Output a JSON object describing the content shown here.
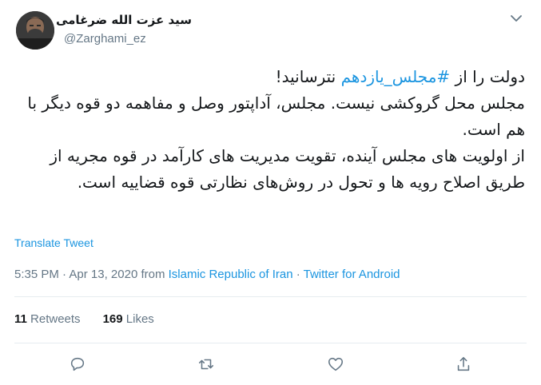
{
  "author": {
    "display_name": "سید عزت الله ضرغامی",
    "handle": "@Zarghami_ez"
  },
  "tweet": {
    "line1_prefix": "دولت را از ",
    "hashtag": "#مجلس_یازدهم",
    "line1_suffix": " نترسانید!",
    "para2": "مجلس محل گروکشی نیست. مجلس، آداپتور وصل و مفاهمه دو قوه دیگر با هم است.",
    "para3": "از اولویت های مجلس آینده، تقویت مدیریت های کارآمد در قوه مجریه از طریق اصلاح رویه ها و تحول در روش‌های نظارتی قوه قضاییه است."
  },
  "translate_label": "Translate Tweet",
  "meta": {
    "time": "5:35 PM",
    "date": "Apr 13, 2020",
    "from_word": "from",
    "location": "Islamic Republic of Iran",
    "client": "Twitter for Android",
    "separator": "·"
  },
  "stats": {
    "retweets_count": "11",
    "retweets_label": "Retweets",
    "likes_count": "169",
    "likes_label": "Likes"
  },
  "icons": {
    "reply": "reply-icon",
    "retweet": "retweet-icon",
    "like": "heart-icon",
    "share": "share-icon",
    "menu": "chevron-down-icon"
  },
  "colors": {
    "link": "#1b95e0",
    "secondary_text": "#657786",
    "primary_text": "#14171a",
    "divider": "#e6ecf0"
  }
}
